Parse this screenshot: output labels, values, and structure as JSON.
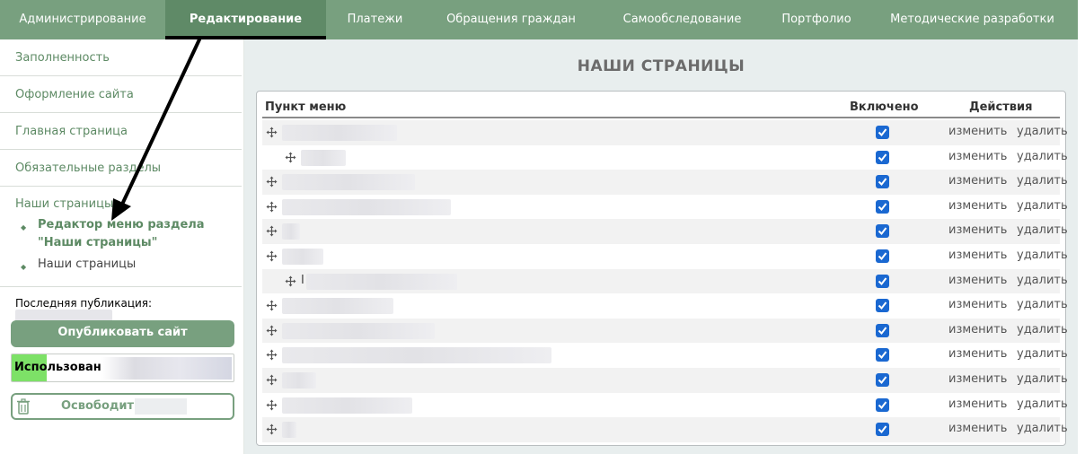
{
  "topnav": {
    "tabs": [
      {
        "label": "Администрирование",
        "active": false
      },
      {
        "label": "Редактирование",
        "active": true
      },
      {
        "label": "Платежи",
        "active": false
      },
      {
        "label": "Обращения граждан",
        "active": false
      },
      {
        "label": "Самообследование",
        "active": false
      },
      {
        "label": "Портфолио",
        "active": false
      },
      {
        "label": "Методические разработки",
        "active": false
      }
    ]
  },
  "sidebar": {
    "items": [
      {
        "label": "Заполненность"
      },
      {
        "label": "Оформление сайта"
      },
      {
        "label": "Главная страница"
      },
      {
        "label": "Обязательные разделы"
      }
    ],
    "group": {
      "title": "Наши страницы",
      "sub_items": [
        {
          "label": "Редактор меню раздела \"Наши страницы\"",
          "active": true
        },
        {
          "label": "Наши страницы",
          "active": false
        }
      ]
    },
    "last_publication_label": "Последняя публикация:",
    "publish_button": "Опубликовать сайт",
    "usage_label": "Использовано",
    "free_button": "Освободить"
  },
  "main": {
    "title": "НАШИ СТРАНИЦЫ",
    "table": {
      "headers": {
        "item": "Пункт меню",
        "enabled": "Включено",
        "actions": "Действия"
      },
      "edit_label": "изменить",
      "delete_label": "удалить",
      "rows": [
        {
          "level": 0,
          "enabled": true,
          "visible_prefix": ""
        },
        {
          "level": 1,
          "enabled": true,
          "visible_prefix": ""
        },
        {
          "level": 0,
          "enabled": true,
          "visible_prefix": ""
        },
        {
          "level": 0,
          "enabled": true,
          "visible_prefix": ""
        },
        {
          "level": 0,
          "enabled": true,
          "visible_prefix": ""
        },
        {
          "level": 0,
          "enabled": true,
          "visible_prefix": ""
        },
        {
          "level": 1,
          "enabled": true,
          "visible_prefix": "I"
        },
        {
          "level": 0,
          "enabled": true,
          "visible_prefix": ""
        },
        {
          "level": 0,
          "enabled": true,
          "visible_prefix": ""
        },
        {
          "level": 0,
          "enabled": true,
          "visible_prefix": ""
        },
        {
          "level": 0,
          "enabled": true,
          "visible_prefix": ""
        },
        {
          "level": 0,
          "enabled": true,
          "visible_prefix": ""
        },
        {
          "level": 0,
          "enabled": true,
          "visible_prefix": ""
        }
      ]
    }
  },
  "colors": {
    "nav_bg": "#78a07f",
    "nav_active_bg": "#5f8a67",
    "accent_green": "#5d8a64",
    "checkbox_blue": "#1a68d1",
    "usage_fill": "#7de167"
  }
}
